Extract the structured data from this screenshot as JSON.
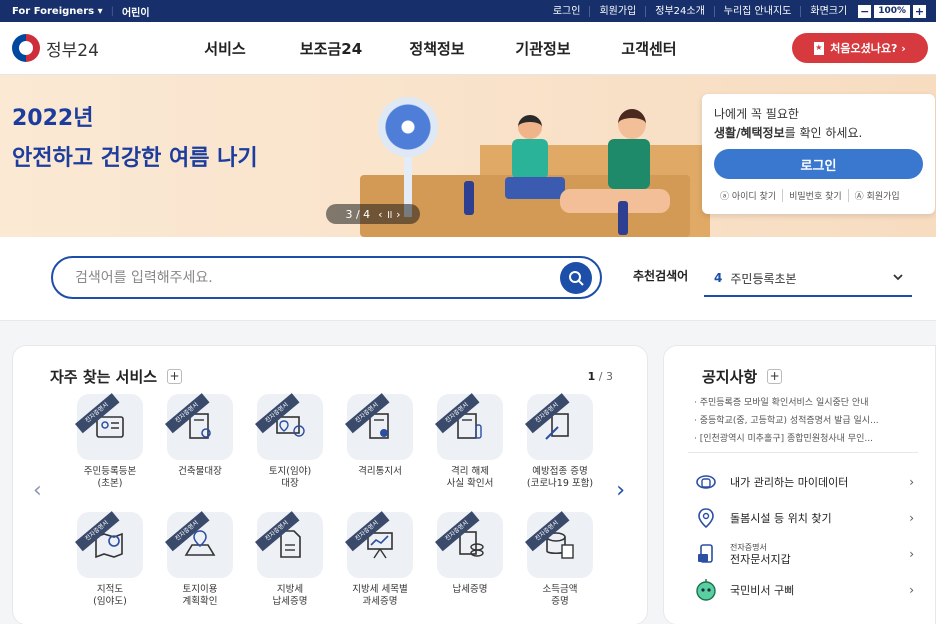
{
  "topbar": {
    "foreigners": "For Foreigners ▾",
    "kids": "어린이",
    "links": [
      "로그인",
      "회원가입",
      "정부24소개",
      "누리집 안내지도",
      "화면크기"
    ],
    "zoom_minus": "−",
    "zoom_value": "100%",
    "zoom_plus": "+"
  },
  "header": {
    "logo_text": "정부24",
    "nav": [
      "서비스",
      "보조금24",
      "정책정보",
      "기관정보",
      "고객센터"
    ],
    "cta_label": "처음오셨나요?  ›"
  },
  "hero": {
    "line1": "2022년",
    "line2": "안전하고 건강한 여름 나기",
    "pager": "3 / 4",
    "pager_controls": "‹  ॥  ›"
  },
  "login": {
    "message_line1": "나에게 꼭 필요한",
    "message_bold": "생활/혜택정보",
    "message_rest": "를 확인 하세요.",
    "button": "로그인",
    "links": [
      "ⓐ 아이디 찾기",
      "비밀번호 찾기",
      "Ⓐ 회원가입"
    ]
  },
  "search": {
    "placeholder": "검색어를 입력해주세요.",
    "recommend_label": "추천검색어",
    "recommend_rank": "4",
    "recommend_value": "주민등록초본"
  },
  "frequent": {
    "title": "자주 찾는 서비스",
    "plus": "+",
    "page_current": "1",
    "page_total": " / 3",
    "badge": "전자증명서",
    "items": [
      {
        "label1": "주민등록등본",
        "label2": "(초본)",
        "icon": "id-card-icon",
        "badge": true
      },
      {
        "label1": "건축물대장",
        "label2": "",
        "icon": "document-search-icon",
        "badge": true
      },
      {
        "label1": "토지(임야)",
        "label2": "대장",
        "icon": "land-map-icon",
        "badge": true
      },
      {
        "label1": "격리통지서",
        "label2": "",
        "icon": "quarantine-notice-icon",
        "badge": true
      },
      {
        "label1": "격리 해제",
        "label2": "사실 확인서",
        "icon": "quarantine-release-icon",
        "badge": true
      },
      {
        "label1": "예방접종 증명",
        "label2": "(코로나19 포함)",
        "icon": "vaccine-icon",
        "badge": true
      },
      {
        "label1": "지적도",
        "label2": "(임야도)",
        "icon": "cadastral-map-icon",
        "badge": true
      },
      {
        "label1": "토지이용",
        "label2": "계획확인",
        "icon": "land-use-icon",
        "badge": true
      },
      {
        "label1": "지방세",
        "label2": "납세증명",
        "icon": "tax-document-icon",
        "badge": true
      },
      {
        "label1": "지방세 세목별",
        "label2": "과세증명",
        "icon": "tax-chart-icon",
        "badge": true
      },
      {
        "label1": "납세증명",
        "label2": "",
        "icon": "tax-payment-icon",
        "badge": true
      },
      {
        "label1": "소득금액",
        "label2": "증명",
        "icon": "income-certificate-icon",
        "badge": true
      }
    ]
  },
  "notice": {
    "title": "공지사항",
    "plus": "+",
    "items": [
      "· 주민등록증 모바일 확인서비스 일시중단 안내",
      "· 중등학교(중, 고등학교) 성적증명서 발급 일시...",
      "· [인천광역시 미추홀구] 종합민원청사내 무인..."
    ],
    "quick_links": [
      {
        "label": "내가 관리하는 마이데이터",
        "small": "",
        "icon": "mydata-icon"
      },
      {
        "label": "돌봄시설 등 위치 찾기",
        "small": "",
        "icon": "location-pin-icon"
      },
      {
        "label": "전자문서지갑",
        "small": "전자증명서",
        "icon": "document-wallet-icon"
      },
      {
        "label": "국민비서 구삐",
        "small": "",
        "icon": "assistant-robot-icon"
      }
    ]
  }
}
